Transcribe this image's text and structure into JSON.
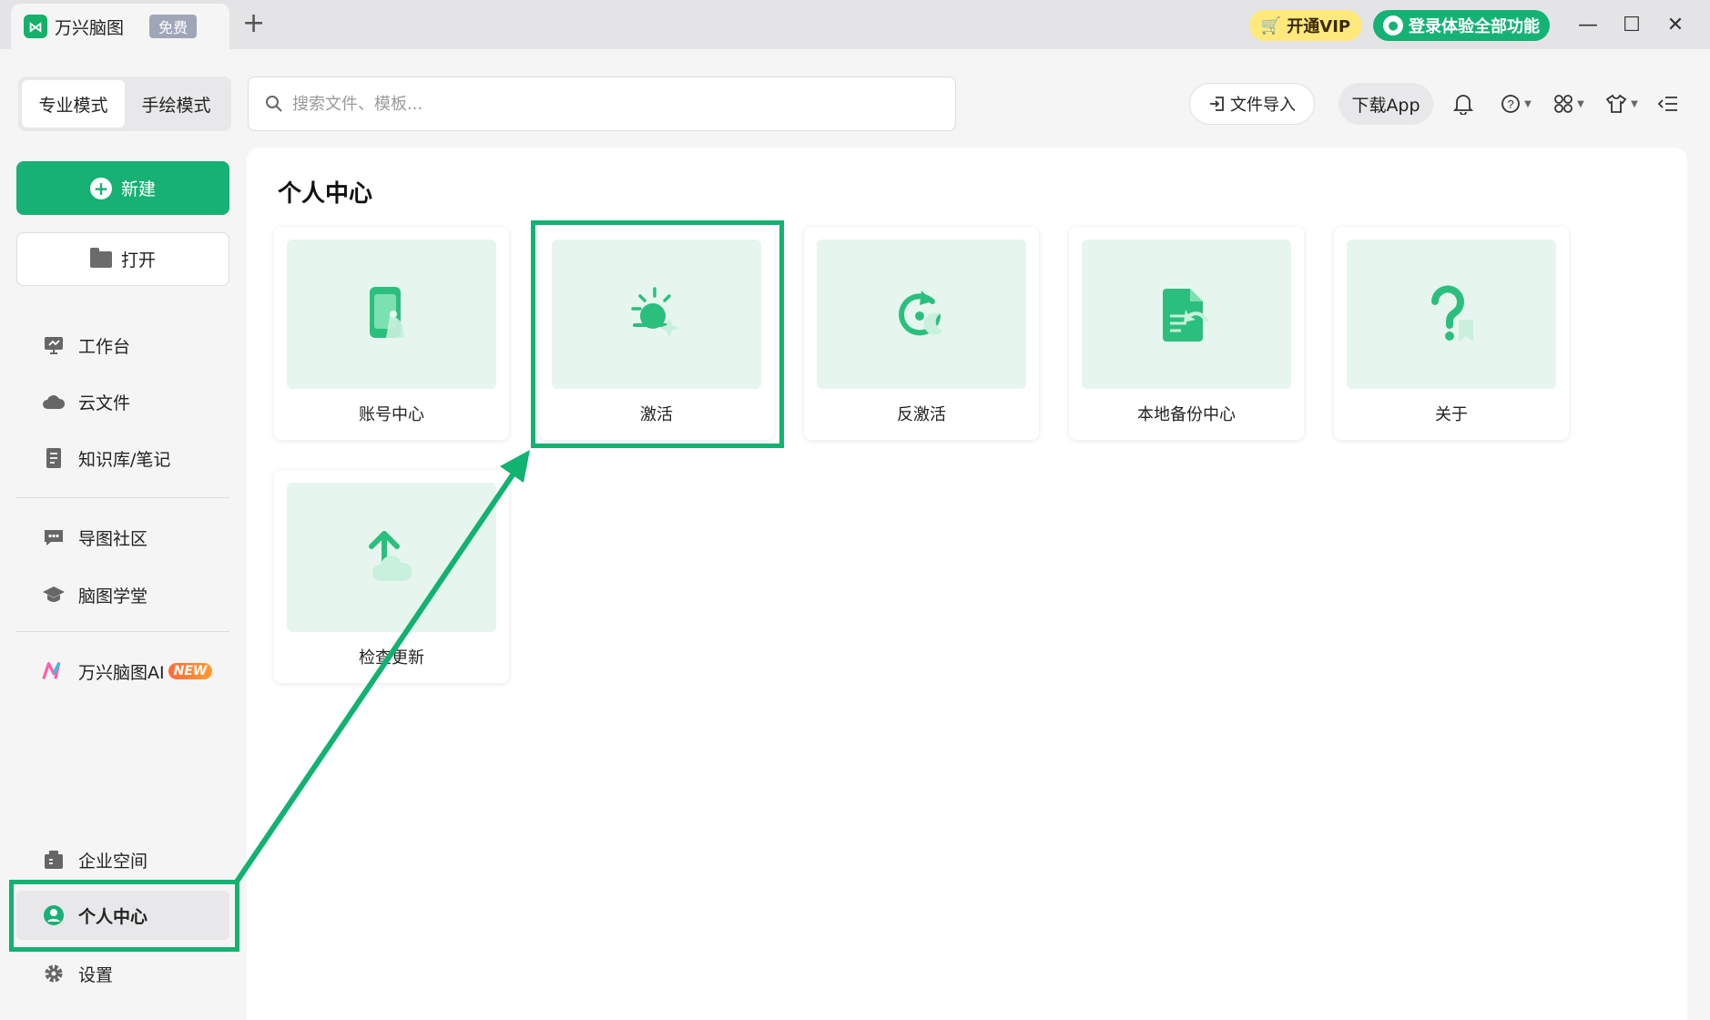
{
  "titlebar": {
    "app_title": "万兴脑图",
    "free_badge": "免费",
    "new_tab": "+",
    "vip_label": "开通VIP",
    "login_label": "登录体验全部功能",
    "minimize": "—",
    "maximize": "☐",
    "close": "✕"
  },
  "toolbar": {
    "modes": [
      "专业模式",
      "手绘模式"
    ],
    "search_placeholder": "搜索文件、模板...",
    "import_label": "文件导入",
    "app_label": "下载App"
  },
  "sidebar": {
    "new_label": "新建",
    "open_label": "打开",
    "items_top": [
      "工作台",
      "云文件",
      "知识库/笔记"
    ],
    "items_mid": [
      "导图社区",
      "脑图学堂"
    ],
    "ai_label": "万兴脑图AI",
    "ai_tag": "NEW",
    "items_bottom": [
      "企业空间",
      "个人中心",
      "设置"
    ]
  },
  "main": {
    "title": "个人中心",
    "cards": [
      "账号中心",
      "激活",
      "反激活",
      "本地备份中心",
      "关于",
      "检查更新"
    ]
  },
  "colors": {
    "accent": "#16b173",
    "card_thumb": "#e6f6ee",
    "vip": "#ffe87c",
    "annotation": "#12b271"
  }
}
